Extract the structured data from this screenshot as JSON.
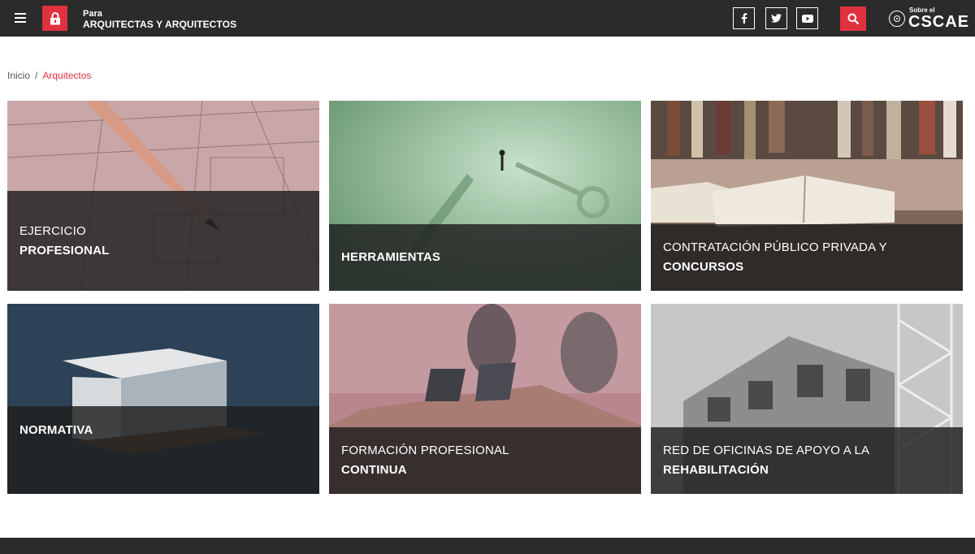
{
  "header": {
    "para_small": "Para",
    "para_big": "ARQUITECTAS Y ARQUITECTOS",
    "social": [
      "facebook-icon",
      "twitter-icon",
      "youtube-icon"
    ],
    "brand_small": "Sobre el",
    "brand_big": "CSCAE",
    "accent": "#e0313f",
    "bar_color": "#2b2b2b"
  },
  "breadcrumb": {
    "home": "Inicio",
    "separator": "/",
    "current": "Arquitectos"
  },
  "tiles": [
    {
      "line1": "EJERCICIO",
      "line2": "PROFESIONAL"
    },
    {
      "line1": "",
      "line2": "HERRAMIENTAS"
    },
    {
      "line1": "CONTRATACIÓN PÚBLICO PRIVADA Y",
      "line2": "CONCURSOS"
    },
    {
      "line1": "",
      "line2": "NORMATIVA"
    },
    {
      "line1": "FORMACIÓN PROFESIONAL",
      "line2": "CONTINUA"
    },
    {
      "line1": "RED DE OFICINAS DE APOYO A LA",
      "line2": "REHABILITACIÓN"
    }
  ]
}
